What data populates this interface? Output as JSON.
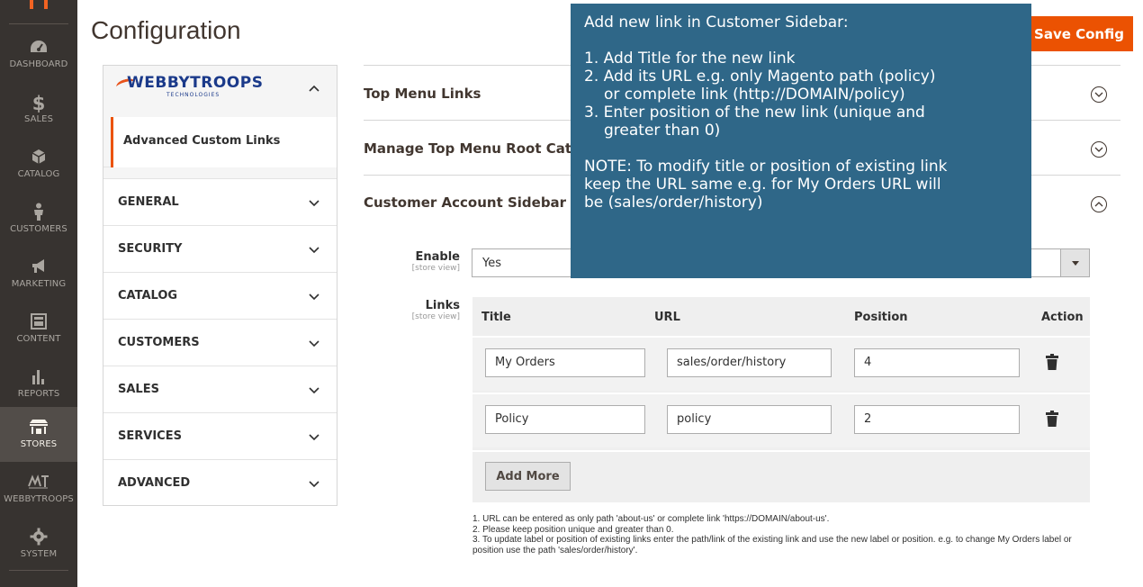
{
  "nav": {
    "items": [
      {
        "label": "DASHBOARD",
        "icon": "dashboard-icon"
      },
      {
        "label": "SALES",
        "icon": "dollar-icon"
      },
      {
        "label": "CATALOG",
        "icon": "box-icon"
      },
      {
        "label": "CUSTOMERS",
        "icon": "person-icon"
      },
      {
        "label": "MARKETING",
        "icon": "megaphone-icon"
      },
      {
        "label": "CONTENT",
        "icon": "layout-icon"
      },
      {
        "label": "REPORTS",
        "icon": "bar-chart-icon"
      },
      {
        "label": "STORES",
        "icon": "store-icon"
      },
      {
        "label": "WEBBYTROOPS",
        "icon": "webbytroops-icon"
      },
      {
        "label": "SYSTEM",
        "icon": "gear-icon"
      }
    ],
    "active": "STORES"
  },
  "header": {
    "title": "Configuration",
    "save_label": "Save Config"
  },
  "config_panel": {
    "vendor_logo_text": "WEBBYTROOPS",
    "vendor_logo_sub": "TECHNOLOGIES",
    "active_item": "Advanced Custom Links",
    "sections": [
      "GENERAL",
      "SECURITY",
      "CATALOG",
      "CUSTOMERS",
      "SALES",
      "SERVICES",
      "ADVANCED"
    ]
  },
  "groups": {
    "top_menu": "Top Menu Links",
    "manage_root": "Manage Top Menu Root Cat",
    "customer_sidebar": "Customer Account Sidebar"
  },
  "form": {
    "enable_label": "Enable",
    "enable_scope": "[store view]",
    "enable_value": "Yes",
    "links_label": "Links",
    "links_scope": "[store view]",
    "columns": {
      "title": "Title",
      "url": "URL",
      "position": "Position",
      "action": "Action"
    },
    "rows": [
      {
        "title": "My Orders",
        "url": "sales/order/history",
        "position": "4"
      },
      {
        "title": "Policy",
        "url": "policy",
        "position": "2"
      }
    ],
    "add_more": "Add More",
    "notes": [
      "1. URL can be entered as only path 'about-us' or complete link 'https://DOMAIN/about-us'.",
      "2. Please keep position unique and greater than 0.",
      "3. To update label or position of existing links enter the path/link of the existing link and use the new label or position. e.g. to change My Orders label or position use the path 'sales/order/history'."
    ]
  },
  "tooltip": {
    "heading": "Add new link in Customer Sidebar:",
    "step1": "1. Add Title for the new link",
    "step2a": "2. Add its URL e.g. only Magento path (policy)",
    "step2b": "or complete link (http://DOMAIN/policy)",
    "step3a": "3. Enter position of the new link (unique and",
    "step3b": "greater than 0)",
    "note_a": "NOTE: To modify title or position of existing link",
    "note_b": "keep the URL same e.g. for My Orders URL will",
    "note_c": "be (sales/order/history)"
  },
  "colors": {
    "nav_bg": "#373330",
    "accent": "#eb5202",
    "tooltip_bg": "#2f6788"
  }
}
